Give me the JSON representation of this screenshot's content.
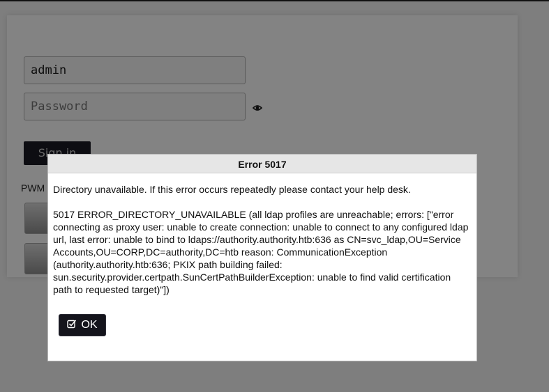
{
  "login_form": {
    "username_value": "admin",
    "password_placeholder": "Password",
    "show_password_icon": "eye-icon",
    "sign_in_label": "Sign in"
  },
  "footer": {
    "pwm_label": "PWM"
  },
  "dialog": {
    "title": "Error 5017",
    "message": "Directory unavailable. If this error occurs repeatedly please contact your help desk.",
    "details": "5017 ERROR_DIRECTORY_UNAVAILABLE (all ldap profiles are unreachable; errors: [\"error connecting as proxy user: unable to create connection: unable to connect to any configured ldap url, last error: unable to bind to ldaps://authority.authority.htb:636 as CN=svc_ldap,OU=Service Accounts,OU=CORP,DC=authority,DC=htb reason: CommunicationException (authority.authority.htb:636; PKIX path building failed: sun.security.provider.certpath.SunCertPathBuilderException: unable to find valid certification path to requested target)\"])",
    "ok_label": "OK",
    "ok_icon": "checkbox-check-icon"
  },
  "colors": {
    "overlay_background": "#7e7e7e",
    "dialog_titlebar": "#e6e6e6",
    "button_dark": "#14141c"
  }
}
